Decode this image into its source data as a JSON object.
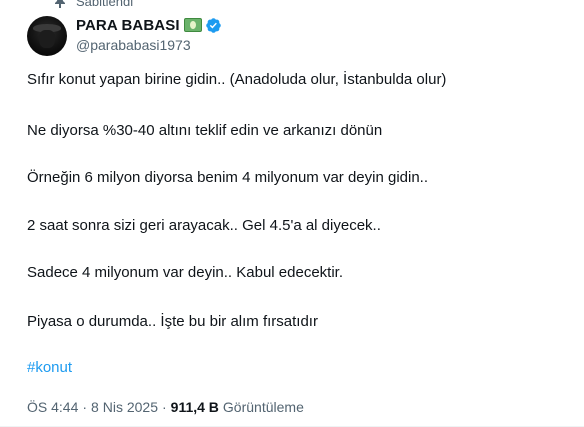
{
  "pinned": {
    "label": "Sabitlendi"
  },
  "author": {
    "display_name": "PARA BABASI",
    "handle": "@parababasi1973",
    "name_emoji": "money-banknote-emoji",
    "verified_icon": "verified-badge-icon"
  },
  "tweet": {
    "lines": [
      "Sıfır konut yapan birine gidin.. (Anadoluda olur, İstanbulda olur)",
      "Ne diyorsa %30-40 altını teklif edin ve arkanızı dönün",
      "Örneğin 6 milyon diyorsa benim 4 milyonum var deyin gidin..",
      "2 saat sonra sizi geri arayacak.. Gel 4.5'a al diyecek..",
      "Sadece 4 milyonum var deyin.. Kabul edecektir.",
      "Piyasa o durumda.. İşte bu bir alım fırsatıdır"
    ],
    "hashtag": "#konut"
  },
  "meta": {
    "time": "ÖS 4:44",
    "date": "8 Nis 2025",
    "views_count": "911,4 B",
    "views_label": "Görüntüleme",
    "separator": "·"
  },
  "colors": {
    "text": "#0f1419",
    "secondary": "#536471",
    "link": "#1d9bf0",
    "verified": "#1d9bf0"
  }
}
